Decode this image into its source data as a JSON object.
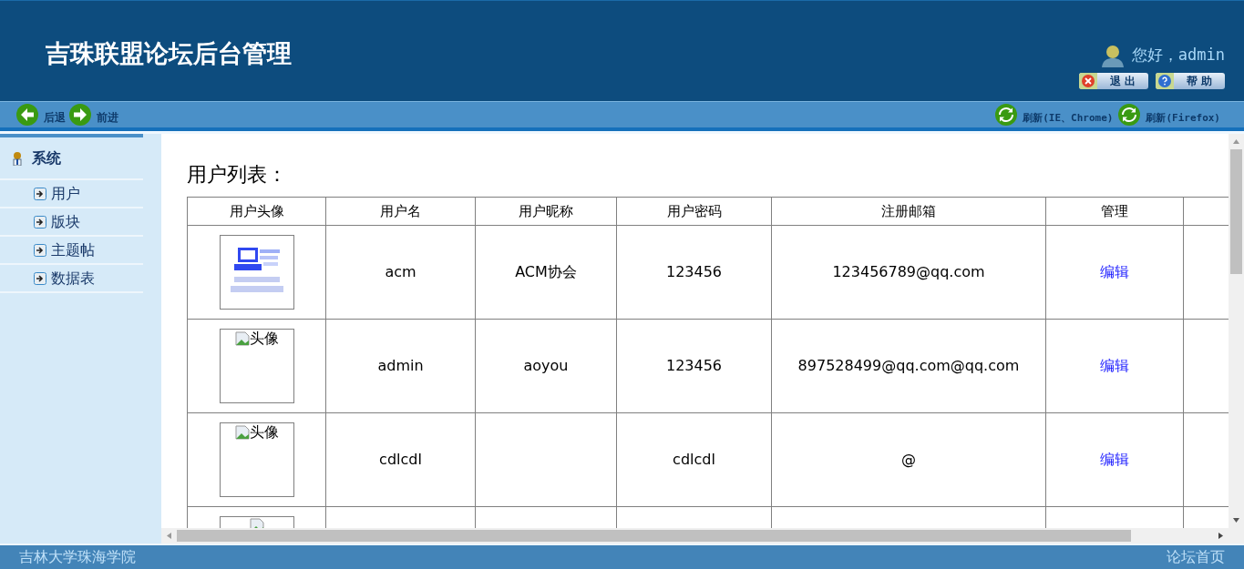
{
  "header": {
    "title": "吉珠联盟论坛后台管理",
    "greeting": "您好，admin",
    "buttons": [
      {
        "label": "退 出",
        "kind": "logout"
      },
      {
        "label": "帮 助",
        "kind": "help"
      }
    ]
  },
  "toolbar": {
    "left": [
      {
        "label": "后退",
        "kind": "back"
      },
      {
        "label": "前进",
        "kind": "forward"
      }
    ],
    "right": [
      {
        "label": "刷新(IE、Chrome)",
        "kind": "refresh"
      },
      {
        "label": "刷新(Firefox)",
        "kind": "refresh"
      }
    ]
  },
  "sidebar": {
    "group": "系统",
    "items": [
      "用户",
      "版块",
      "主题帖",
      "数据表"
    ]
  },
  "content": {
    "title": "用户列表：",
    "table": {
      "columns": [
        "用户头像",
        "用户名",
        "用户昵称",
        "用户密码",
        "注册邮箱",
        "管理"
      ],
      "rows": [
        {
          "avatar": {
            "kind": "logo"
          },
          "username": "acm",
          "nickname": "ACM协会",
          "password": "123456",
          "email": "123456789@qq.com",
          "action": "编辑"
        },
        {
          "avatar": {
            "kind": "broken",
            "alt": "头像"
          },
          "username": "admin",
          "nickname": "aoyou",
          "password": "123456",
          "email": "897528499@qq.com@qq.com",
          "action": "编辑"
        },
        {
          "avatar": {
            "kind": "broken",
            "alt": "头像"
          },
          "username": "cdlcdl",
          "nickname": "",
          "password": "cdlcdl",
          "email": "@",
          "action": "编辑"
        },
        {
          "avatar": {
            "kind": "broken"
          }
        }
      ]
    }
  },
  "footer": {
    "left": "吉林大学珠海学院",
    "right": "论坛首页"
  }
}
